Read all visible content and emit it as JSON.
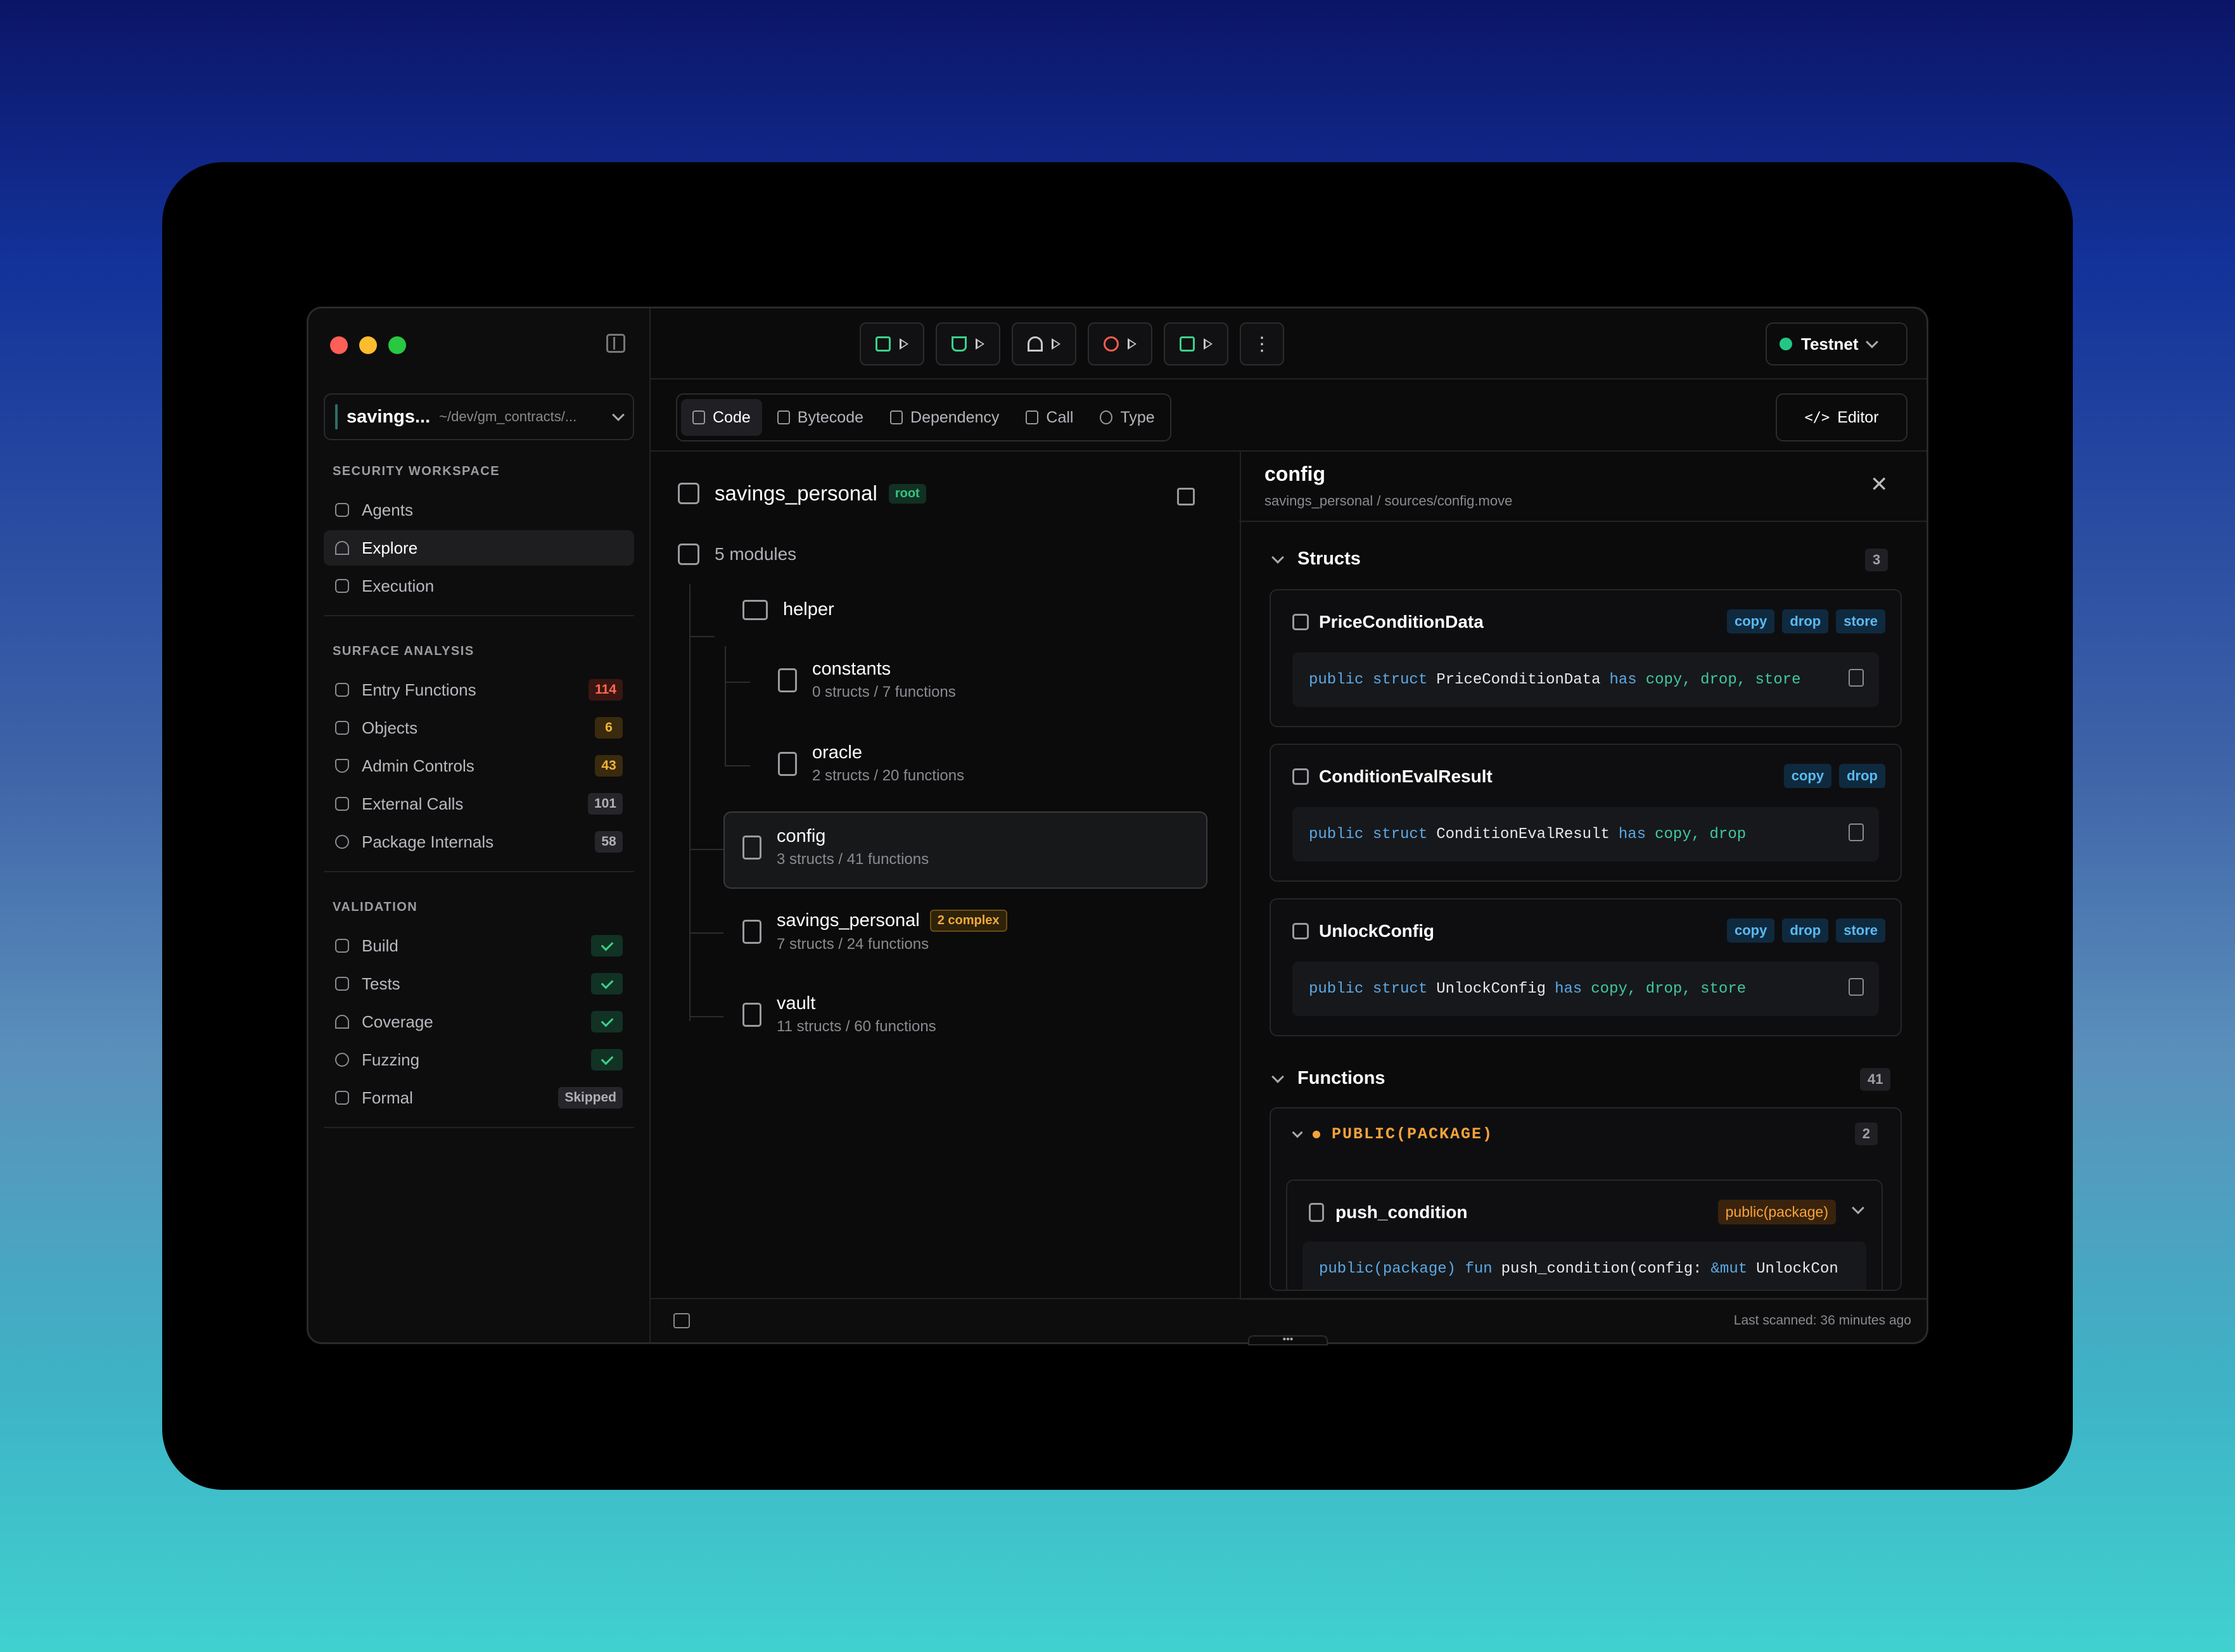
{
  "window": {
    "network": "Testnet"
  },
  "sidebar": {
    "project": {
      "name": "savings...",
      "path": "~/dev/gm_contracts/..."
    },
    "sections": [
      {
        "title": "SECURITY WORKSPACE",
        "items": [
          {
            "label": "Agents",
            "icon": "robot-icon"
          },
          {
            "label": "Explore",
            "icon": "gauge-icon"
          },
          {
            "label": "Execution",
            "icon": "route-icon"
          }
        ]
      },
      {
        "title": "SURFACE ANALYSIS",
        "items": [
          {
            "label": "Entry Functions",
            "badge": "114",
            "icon": "branch-icon"
          },
          {
            "label": "Objects",
            "badge": "6",
            "icon": "cubes-icon"
          },
          {
            "label": "Admin Controls",
            "badge": "43",
            "icon": "shield-icon"
          },
          {
            "label": "External Calls",
            "badge": "101",
            "icon": "network-icon"
          },
          {
            "label": "Package Internals",
            "badge": "58",
            "icon": "link-icon"
          }
        ]
      },
      {
        "title": "VALIDATION",
        "items": [
          {
            "label": "Build",
            "icon": "hammer-icon"
          },
          {
            "label": "Tests",
            "icon": "file-icon"
          },
          {
            "label": "Coverage",
            "icon": "gauge-icon"
          },
          {
            "label": "Fuzzing",
            "icon": "target-icon"
          },
          {
            "label": "Formal",
            "badge": "Skipped",
            "icon": "doc-icon"
          }
        ]
      }
    ]
  },
  "tabs": [
    {
      "label": "Code"
    },
    {
      "label": "Bytecode"
    },
    {
      "label": "Dependency"
    },
    {
      "label": "Call"
    },
    {
      "label": "Type"
    }
  ],
  "editor_label": "Editor",
  "package": {
    "name": "savings_personal",
    "tag": "root",
    "modules_label": "5 modules",
    "folder": "helper",
    "modules": [
      {
        "name": "constants",
        "meta": "0 structs / 7 functions"
      },
      {
        "name": "oracle",
        "meta": "2 structs / 20 functions"
      },
      {
        "name": "config",
        "meta": "3 structs / 41 functions"
      },
      {
        "name": "savings_personal",
        "meta": "7 structs / 24 functions",
        "tag": "2 complex"
      },
      {
        "name": "vault",
        "meta": "11 structs / 60 functions"
      }
    ]
  },
  "detail": {
    "title": "config",
    "path": "savings_personal / sources/config.move",
    "structs_label": "Structs",
    "structs_count": "3",
    "structs": [
      {
        "name": "PriceConditionData",
        "abilities": [
          "copy",
          "drop",
          "store"
        ],
        "code": {
          "kw": "public struct",
          "name": "PriceConditionData",
          "has": "has",
          "abil": "copy, drop, store"
        }
      },
      {
        "name": "ConditionEvalResult",
        "abilities": [
          "copy",
          "drop"
        ],
        "code": {
          "kw": "public struct",
          "name": "ConditionEvalResult",
          "has": "has",
          "abil": "copy, drop"
        }
      },
      {
        "name": "UnlockConfig",
        "abilities": [
          "copy",
          "drop",
          "store"
        ],
        "code": {
          "kw": "public struct",
          "name": "UnlockConfig",
          "has": "has",
          "abil": "copy, drop, store"
        }
      }
    ],
    "functions_label": "Functions",
    "functions_count": "41",
    "group": {
      "label": "PUBLIC(PACKAGE)",
      "count": "2"
    },
    "fn": {
      "name": "push_condition",
      "vis": "public(package)",
      "code_kw": "public(package) fun",
      "code_name": "push_condition(config:",
      "code_mut": "&mut",
      "code_rest": "UnlockCon"
    }
  },
  "status": {
    "scan": "Last scanned: 36 minutes ago"
  }
}
